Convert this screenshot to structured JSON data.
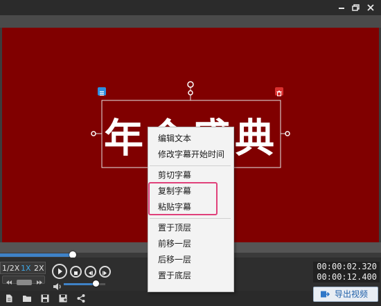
{
  "window": {
    "minimize_icon": "minimize-icon",
    "restore_icon": "restore-icon",
    "close_icon": "close-icon"
  },
  "canvas": {
    "subtitle_text": "年会盛典",
    "background_color": "#800000"
  },
  "context_menu": {
    "items": [
      {
        "label": "编辑文本"
      },
      {
        "label": "修改字幕开始时间"
      },
      {
        "label": "剪切字幕"
      },
      {
        "label": "复制字幕"
      },
      {
        "label": "粘贴字幕"
      },
      {
        "label": "置于顶层"
      },
      {
        "label": "前移一层"
      },
      {
        "label": "后移一层"
      },
      {
        "label": "置于底层"
      }
    ],
    "highlight_color": "#e0407a"
  },
  "playback": {
    "progress_fraction": 0.19,
    "volume_fraction": 0.76,
    "speed_options": [
      "1/2X",
      "1X",
      "2X"
    ],
    "active_speed": "1X",
    "current_time": "00:00:02.320",
    "total_time": "00:00:12.400"
  },
  "export": {
    "label": "导出视频"
  },
  "colors": {
    "accent": "#3f82c7",
    "delete": "#d9302f"
  }
}
